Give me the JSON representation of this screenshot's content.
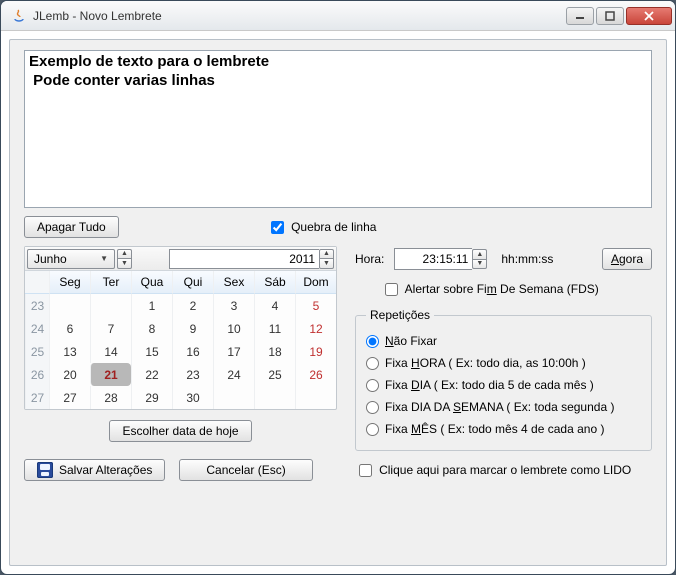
{
  "window": {
    "title": "JLemb - Novo Lembrete"
  },
  "editor": {
    "text": "Exemplo de texto para o lembrete\n Pode conter varias linhas"
  },
  "toolbar": {
    "clear_label": "Apagar Tudo",
    "wrap_label": "Quebra de linha",
    "wrap_checked": true
  },
  "calendar": {
    "month": "Junho",
    "year": "2011",
    "dow": [
      "Seg",
      "Ter",
      "Qua",
      "Qui",
      "Sex",
      "Sáb",
      "Dom"
    ],
    "weeks": [
      {
        "no": 23,
        "days": [
          "",
          "",
          "1",
          "2",
          "3",
          "4",
          "5"
        ]
      },
      {
        "no": 24,
        "days": [
          "6",
          "7",
          "8",
          "9",
          "10",
          "11",
          "12"
        ]
      },
      {
        "no": 25,
        "days": [
          "13",
          "14",
          "15",
          "16",
          "17",
          "18",
          "19"
        ]
      },
      {
        "no": 26,
        "days": [
          "20",
          "21",
          "22",
          "23",
          "24",
          "25",
          "26"
        ]
      },
      {
        "no": 27,
        "days": [
          "27",
          "28",
          "29",
          "30",
          "",
          "",
          ""
        ]
      }
    ],
    "today": "21",
    "today_button": "Escolher data de hoje"
  },
  "time": {
    "label": "Hora:",
    "value": "23:15:11",
    "format": "hh:mm:ss",
    "now_button": "Agora"
  },
  "weekend": {
    "prefix": "Alertar sobre Fi",
    "und": "m",
    "suffix": " De Semana (FDS)",
    "checked": false
  },
  "reps": {
    "legend": "Repetições",
    "options": [
      {
        "prefix": "",
        "und": "N",
        "suffix": "ão Fixar",
        "selected": true
      },
      {
        "prefix": "Fixa ",
        "und": "H",
        "suffix": "ORA  ( Ex: todo dia, as 10:00h )",
        "selected": false
      },
      {
        "prefix": "Fixa ",
        "und": "D",
        "suffix": "IA  ( Ex: todo dia 5 de cada mês )",
        "selected": false
      },
      {
        "prefix": "Fixa DIA DA ",
        "und": "S",
        "suffix": "EMANA  ( Ex: toda segunda )",
        "selected": false
      },
      {
        "prefix": "Fixa ",
        "und": "M",
        "suffix": "ÊS  ( Ex: todo mês 4 de cada ano )",
        "selected": false
      }
    ]
  },
  "footer": {
    "save": "Salvar Alterações",
    "cancel": "Cancelar (Esc)",
    "mark_read": "Clique aqui para marcar o lembrete como LIDO",
    "mark_read_checked": false
  }
}
